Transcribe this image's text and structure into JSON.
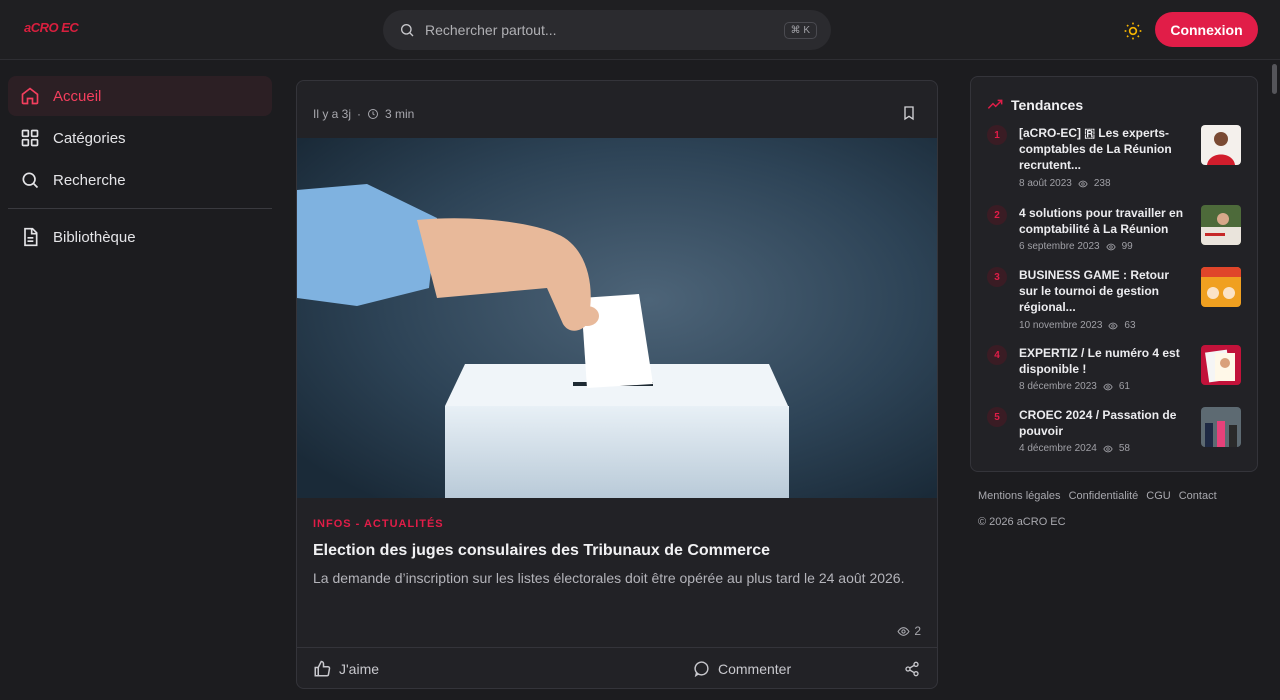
{
  "header": {
    "logo_text": "aCRO EC",
    "search_placeholder": "Rechercher partout...",
    "search_shortcut": "⌘ K",
    "login_label": "Connexion"
  },
  "sidebar": {
    "items": [
      {
        "label": "Accueil",
        "icon": "home-icon",
        "active": true
      },
      {
        "label": "Catégories",
        "icon": "grid-icon"
      },
      {
        "label": "Recherche",
        "icon": "search-icon"
      },
      {
        "label": "Bibliothèque",
        "icon": "document-icon"
      }
    ]
  },
  "post": {
    "time_ago": "Il y a 3j",
    "separator": "·",
    "read_time": "3 min",
    "category": "INFOS - ACTUALITÉS",
    "title": "Election des juges consulaires des Tribunaux de Commerce",
    "description": "La demande d’inscription sur les listes électorales doit être opérée au plus tard le 24 août 2026.",
    "views": "2",
    "like_label": "J'aime",
    "comment_label": "Commenter"
  },
  "trends": {
    "title": "Tendances",
    "items": [
      {
        "rank": "1",
        "title": "[aCRO-EC] 🇷 Les experts-comptables de La Réunion recrutent...",
        "date": "8 août 2023",
        "views": "238"
      },
      {
        "rank": "2",
        "title": "4 solutions pour travailler en comptabilité à La Réunion",
        "date": "6 septembre 2023",
        "views": "99"
      },
      {
        "rank": "3",
        "title": "BUSINESS GAME : Retour sur le tournoi de gestion régional...",
        "date": "10 novembre 2023",
        "views": "63"
      },
      {
        "rank": "4",
        "title": "EXPERTIZ / Le numéro 4 est disponible !",
        "date": "8 décembre 2023",
        "views": "61"
      },
      {
        "rank": "5",
        "title": "CROEC 2024 / Passation de pouvoir",
        "date": "4 décembre 2024",
        "views": "58"
      }
    ]
  },
  "footer": {
    "links": [
      "Mentions légales",
      "Confidentialité",
      "CGU",
      "Contact"
    ],
    "copyright": "© 2026 aCRO EC"
  },
  "colors": {
    "accent": "#e11d48",
    "background": "#1c1c1f",
    "card": "#222226"
  }
}
